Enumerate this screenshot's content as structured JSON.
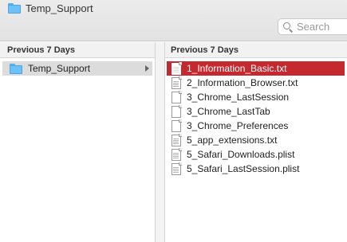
{
  "window": {
    "title": "Temp_Support",
    "title_icon": "folder-icon"
  },
  "search": {
    "placeholder": "Search",
    "icon": "search-icon"
  },
  "sidebar_column": {
    "group_label": "Previous 7 Days",
    "items": [
      {
        "label": "Temp_Support",
        "icon": "folder-icon",
        "selected": true,
        "has_children": true
      }
    ]
  },
  "files_column": {
    "group_label": "Previous 7 Days",
    "items": [
      {
        "label": "1_Information_Basic.txt",
        "icon": "text-file-icon",
        "selected": true
      },
      {
        "label": "2_Information_Browser.txt",
        "icon": "text-file-icon",
        "selected": false
      },
      {
        "label": "3_Chrome_LastSession",
        "icon": "blank-file-icon",
        "selected": false
      },
      {
        "label": "3_Chrome_LastTab",
        "icon": "blank-file-icon",
        "selected": false
      },
      {
        "label": "3_Chrome_Preferences",
        "icon": "blank-file-icon",
        "selected": false
      },
      {
        "label": "5_app_extensions.txt",
        "icon": "text-file-icon",
        "selected": false
      },
      {
        "label": "5_Safari_Downloads.plist",
        "icon": "text-file-icon",
        "selected": false
      },
      {
        "label": "5_Safari_LastSession.plist",
        "icon": "text-file-icon",
        "selected": false
      }
    ]
  },
  "colors": {
    "selection": "#c5292f",
    "folder": "#6cc1f7"
  }
}
